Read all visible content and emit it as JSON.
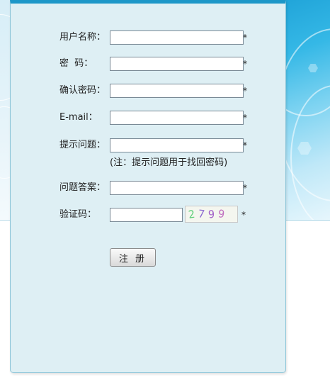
{
  "form": {
    "fields": [
      {
        "label": "用户名称：",
        "value": "",
        "required_mark": "*"
      },
      {
        "label": "密  码：",
        "value": "",
        "required_mark": "*"
      },
      {
        "label": "确认密码：",
        "value": "",
        "required_mark": "*"
      },
      {
        "label": "E-mail：",
        "value": "",
        "required_mark": "*"
      },
      {
        "label": "提示问题：",
        "value": "",
        "required_mark": "*"
      },
      {
        "label": "问题答案：",
        "value": "",
        "required_mark": "*"
      },
      {
        "label": "验证码：",
        "value": "",
        "required_mark": "*"
      }
    ],
    "hint_text": "(注：提示问题用于找回密码)",
    "captcha": {
      "text": "2799",
      "digits": [
        "2",
        "7",
        "9",
        "9"
      ],
      "digit_colors": [
        "#5fcf7a",
        "#8c6bd1",
        "#a05fc7",
        "#c070c0"
      ]
    },
    "submit_label": "注 册"
  },
  "colors": {
    "panel_bg": "#deeff4",
    "panel_top_border": "#1d97c8",
    "accent_art": "#35b8e6"
  }
}
